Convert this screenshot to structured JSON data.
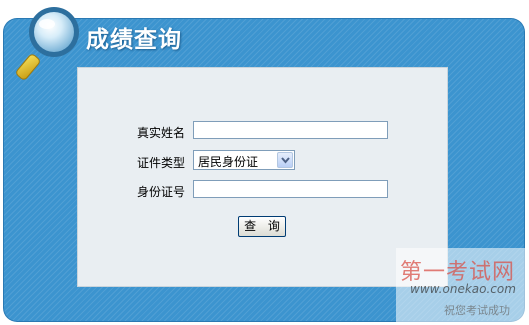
{
  "header": {
    "title": "成绩查询",
    "icon": "magnifier-icon"
  },
  "form": {
    "name_label": "真实姓名",
    "name_value": "",
    "idtype_label": "证件类型",
    "idtype_selected": "居民身份证",
    "idnum_label": "身份证号",
    "idnum_value": "",
    "submit_label": "查 询"
  },
  "watermark": {
    "title": "第一考试网",
    "url": "www.onekao.com",
    "slogan": "祝您考试成功"
  },
  "colors": {
    "panel": "#3c94cf",
    "content_bg": "#e9eef2",
    "title": "#ffffff",
    "watermark": "#d9524a"
  }
}
